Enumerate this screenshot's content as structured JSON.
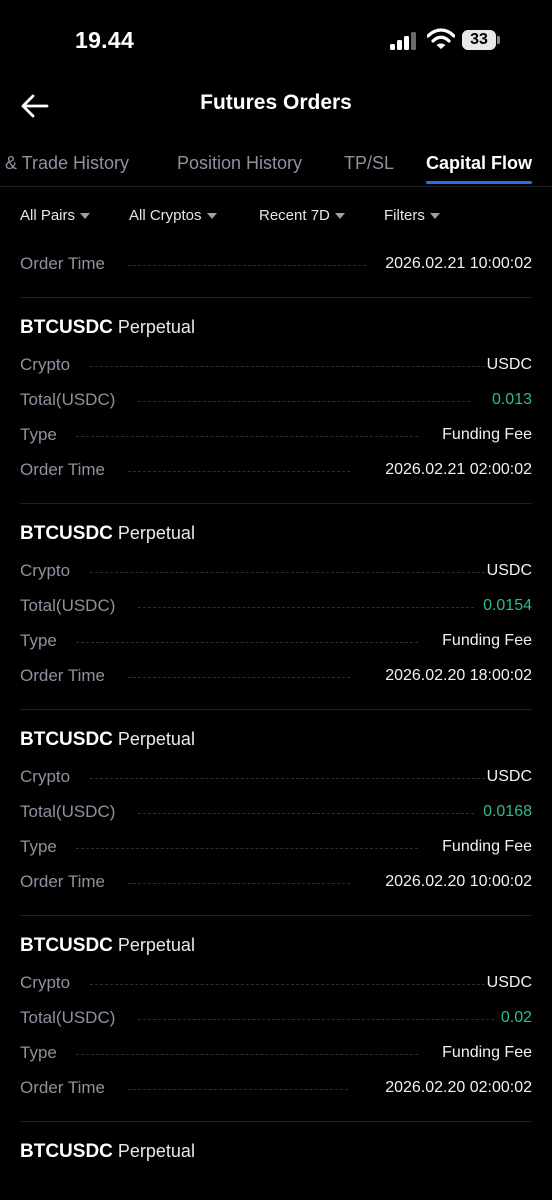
{
  "status_bar": {
    "time": "19.44",
    "battery": "33"
  },
  "header": {
    "title": "Futures Orders"
  },
  "tabs": [
    {
      "label": "r & Trade History"
    },
    {
      "label": "Position History"
    },
    {
      "label": "TP/SL"
    },
    {
      "label": "Capital Flow"
    }
  ],
  "filters": [
    {
      "label": "All Pairs"
    },
    {
      "label": "All Cryptos"
    },
    {
      "label": "Recent 7D"
    },
    {
      "label": "Filters"
    }
  ],
  "partial_record": {
    "order_time_label": "Order Time",
    "order_time": "2026.02.21 10:00:02"
  },
  "field_labels": {
    "crypto": "Crypto",
    "total": "Total(USDC)",
    "type": "Type",
    "order_time": "Order Time"
  },
  "records": [
    {
      "symbol": "BTCUSDC",
      "kind": "Perpetual",
      "crypto": "USDC",
      "total": "0.013",
      "type": "Funding Fee",
      "order_time": "2026.02.21 02:00:02"
    },
    {
      "symbol": "BTCUSDC",
      "kind": "Perpetual",
      "crypto": "USDC",
      "total": "0.0154",
      "type": "Funding Fee",
      "order_time": "2026.02.20 18:00:02"
    },
    {
      "symbol": "BTCUSDC",
      "kind": "Perpetual",
      "crypto": "USDC",
      "total": "0.0168",
      "type": "Funding Fee",
      "order_time": "2026.02.20 10:00:02"
    },
    {
      "symbol": "BTCUSDC",
      "kind": "Perpetual",
      "crypto": "USDC",
      "total": "0.02",
      "type": "Funding Fee",
      "order_time": "2026.02.20 02:00:02"
    },
    {
      "symbol": "BTCUSDC",
      "kind": "Perpetual"
    }
  ],
  "colors": {
    "accent": "#2e6bf0",
    "positive": "#2ebd85",
    "muted": "#8e92a0",
    "background": "#000000"
  },
  "icons": {
    "back": "arrow-left-icon",
    "filter_caret": "caret-down-icon",
    "signal": "cellular-signal-icon",
    "wifi": "wifi-icon",
    "battery": "battery-icon"
  }
}
